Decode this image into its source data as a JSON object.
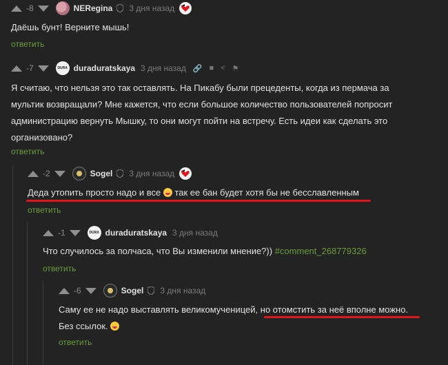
{
  "comments": [
    {
      "rating": "-8",
      "author": "NERegina",
      "date": "3 дня назад",
      "text": "Даёшь бунт! Верните мышь!",
      "reply": "ответить"
    },
    {
      "rating": "-7",
      "author": "duraduratskaya",
      "avatar_text": "DURA",
      "date": "3 дня назад",
      "lines": [
        "Я считаю, что нельзя это так оставлять. На Пикабу были прецеденты, когда из пермача за",
        "мультик возвращали? Мне кажется, что если большое количество пользователей попросит",
        "администрацию вернуть Мышку, то они могут пойти на встречу. Есть идеи как сделать это",
        "организовано?"
      ],
      "reply": "ответить"
    },
    {
      "rating": "-2",
      "author": "Sogel",
      "date": "3 дня назад",
      "text_a": "Деда утопить просто надо и все",
      "text_b": "так ее бан будет хотя бы не бесславленным",
      "reply": "ответить"
    },
    {
      "rating": "-1",
      "author": "duraduratskaya",
      "avatar_text": "DURA",
      "date": "3 дня назад",
      "text": "Что случилось за полчаса, что Вы изменили мнение?))",
      "link": "#comment_268779326",
      "reply": "ответить"
    },
    {
      "rating": "-6",
      "author": "Sogel",
      "date": "3 дня назад",
      "text_a": "Саму ее не надо выставлять великомученицей,",
      "text_b": "но отомстить за неё вполне можно.",
      "text_c": "Без ссылок.",
      "reply": "ответить"
    }
  ],
  "colors": {
    "background": "#232323",
    "reply_link": "#6a9d3a",
    "highlight_underline": "#e0151c"
  }
}
